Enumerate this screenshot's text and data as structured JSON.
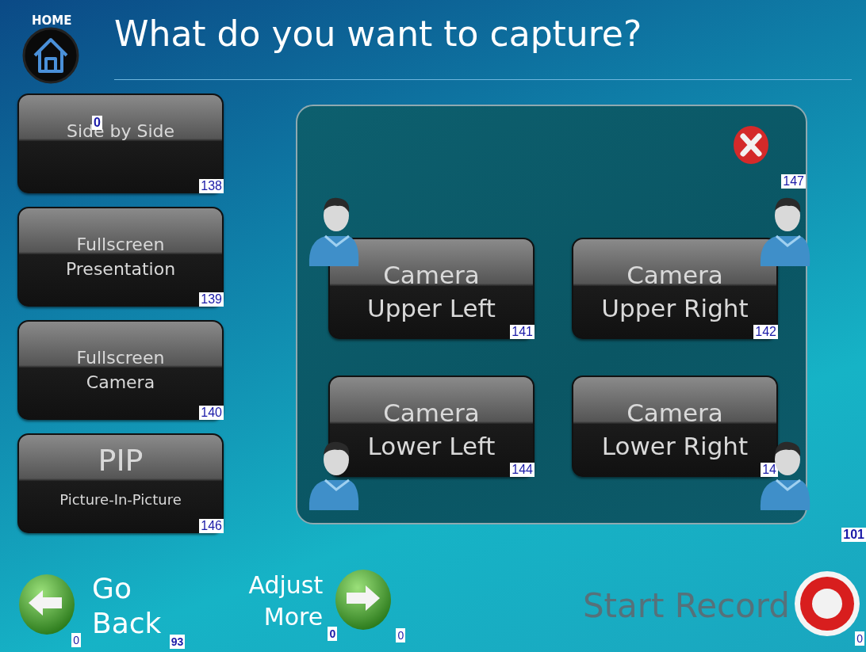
{
  "header": {
    "home_label": "HOME",
    "title": "What do you want to capture?",
    "home_tag": "0"
  },
  "mode_buttons": [
    {
      "kind": "plain",
      "lines": [
        "Side by Side"
      ],
      "tag": "138"
    },
    {
      "kind": "plain",
      "lines": [
        "Fullscreen",
        "Presentation"
      ],
      "tag": "139"
    },
    {
      "kind": "plain",
      "lines": [
        "Fullscreen",
        "Camera"
      ],
      "tag": "140"
    },
    {
      "kind": "pip",
      "lines": [
        "PIP",
        "Picture-In-Picture"
      ],
      "tag": "146"
    }
  ],
  "camera_panel": {
    "close_tag": "147",
    "cameras": [
      {
        "lines": [
          "Camera",
          "Upper Left"
        ],
        "tag": "141",
        "person_top": true,
        "person_left": true
      },
      {
        "lines": [
          "Camera",
          "Upper Right"
        ],
        "tag": "142",
        "person_top": true,
        "person_left": false
      },
      {
        "lines": [
          "Camera",
          "Lower Left"
        ],
        "tag": "144",
        "person_top": false,
        "person_left": true
      },
      {
        "lines": [
          "Camera",
          "Lower Right"
        ],
        "tag": "14",
        "person_top": false,
        "person_left": false
      }
    ]
  },
  "side_tag": "101",
  "footer": {
    "go_back": {
      "lines": [
        "Go",
        "Back"
      ],
      "icon_tag": "0",
      "tag": "93"
    },
    "adjust_more": {
      "lines": [
        "Adjust",
        "More"
      ],
      "tag": "0",
      "icon_tag": "0"
    },
    "start_record": {
      "label": "Start Record",
      "tag": "0"
    }
  }
}
